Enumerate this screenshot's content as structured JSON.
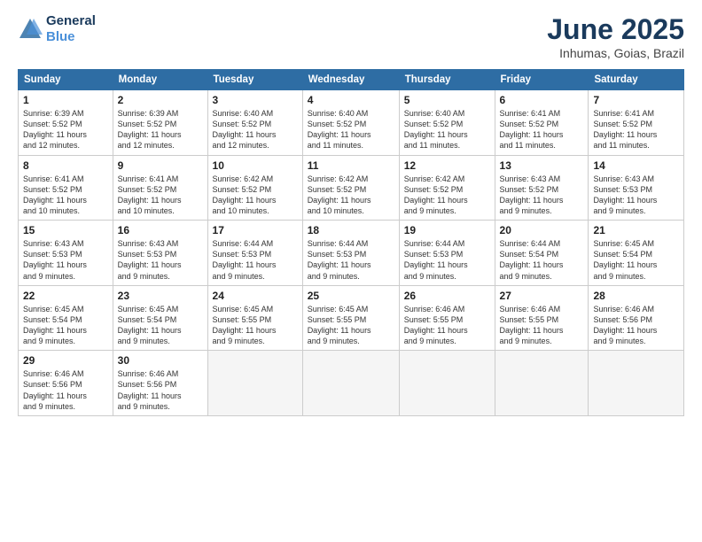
{
  "header": {
    "logo_line1": "General",
    "logo_line2": "Blue",
    "title": "June 2025",
    "subtitle": "Inhumas, Goias, Brazil"
  },
  "weekdays": [
    "Sunday",
    "Monday",
    "Tuesday",
    "Wednesday",
    "Thursday",
    "Friday",
    "Saturday"
  ],
  "weeks": [
    [
      {
        "day": "1",
        "lines": [
          "Sunrise: 6:39 AM",
          "Sunset: 5:52 PM",
          "Daylight: 11 hours",
          "and 12 minutes."
        ]
      },
      {
        "day": "2",
        "lines": [
          "Sunrise: 6:39 AM",
          "Sunset: 5:52 PM",
          "Daylight: 11 hours",
          "and 12 minutes."
        ]
      },
      {
        "day": "3",
        "lines": [
          "Sunrise: 6:40 AM",
          "Sunset: 5:52 PM",
          "Daylight: 11 hours",
          "and 12 minutes."
        ]
      },
      {
        "day": "4",
        "lines": [
          "Sunrise: 6:40 AM",
          "Sunset: 5:52 PM",
          "Daylight: 11 hours",
          "and 11 minutes."
        ]
      },
      {
        "day": "5",
        "lines": [
          "Sunrise: 6:40 AM",
          "Sunset: 5:52 PM",
          "Daylight: 11 hours",
          "and 11 minutes."
        ]
      },
      {
        "day": "6",
        "lines": [
          "Sunrise: 6:41 AM",
          "Sunset: 5:52 PM",
          "Daylight: 11 hours",
          "and 11 minutes."
        ]
      },
      {
        "day": "7",
        "lines": [
          "Sunrise: 6:41 AM",
          "Sunset: 5:52 PM",
          "Daylight: 11 hours",
          "and 11 minutes."
        ]
      }
    ],
    [
      {
        "day": "8",
        "lines": [
          "Sunrise: 6:41 AM",
          "Sunset: 5:52 PM",
          "Daylight: 11 hours",
          "and 10 minutes."
        ]
      },
      {
        "day": "9",
        "lines": [
          "Sunrise: 6:41 AM",
          "Sunset: 5:52 PM",
          "Daylight: 11 hours",
          "and 10 minutes."
        ]
      },
      {
        "day": "10",
        "lines": [
          "Sunrise: 6:42 AM",
          "Sunset: 5:52 PM",
          "Daylight: 11 hours",
          "and 10 minutes."
        ]
      },
      {
        "day": "11",
        "lines": [
          "Sunrise: 6:42 AM",
          "Sunset: 5:52 PM",
          "Daylight: 11 hours",
          "and 10 minutes."
        ]
      },
      {
        "day": "12",
        "lines": [
          "Sunrise: 6:42 AM",
          "Sunset: 5:52 PM",
          "Daylight: 11 hours",
          "and 9 minutes."
        ]
      },
      {
        "day": "13",
        "lines": [
          "Sunrise: 6:43 AM",
          "Sunset: 5:52 PM",
          "Daylight: 11 hours",
          "and 9 minutes."
        ]
      },
      {
        "day": "14",
        "lines": [
          "Sunrise: 6:43 AM",
          "Sunset: 5:53 PM",
          "Daylight: 11 hours",
          "and 9 minutes."
        ]
      }
    ],
    [
      {
        "day": "15",
        "lines": [
          "Sunrise: 6:43 AM",
          "Sunset: 5:53 PM",
          "Daylight: 11 hours",
          "and 9 minutes."
        ]
      },
      {
        "day": "16",
        "lines": [
          "Sunrise: 6:43 AM",
          "Sunset: 5:53 PM",
          "Daylight: 11 hours",
          "and 9 minutes."
        ]
      },
      {
        "day": "17",
        "lines": [
          "Sunrise: 6:44 AM",
          "Sunset: 5:53 PM",
          "Daylight: 11 hours",
          "and 9 minutes."
        ]
      },
      {
        "day": "18",
        "lines": [
          "Sunrise: 6:44 AM",
          "Sunset: 5:53 PM",
          "Daylight: 11 hours",
          "and 9 minutes."
        ]
      },
      {
        "day": "19",
        "lines": [
          "Sunrise: 6:44 AM",
          "Sunset: 5:53 PM",
          "Daylight: 11 hours",
          "and 9 minutes."
        ]
      },
      {
        "day": "20",
        "lines": [
          "Sunrise: 6:44 AM",
          "Sunset: 5:54 PM",
          "Daylight: 11 hours",
          "and 9 minutes."
        ]
      },
      {
        "day": "21",
        "lines": [
          "Sunrise: 6:45 AM",
          "Sunset: 5:54 PM",
          "Daylight: 11 hours",
          "and 9 minutes."
        ]
      }
    ],
    [
      {
        "day": "22",
        "lines": [
          "Sunrise: 6:45 AM",
          "Sunset: 5:54 PM",
          "Daylight: 11 hours",
          "and 9 minutes."
        ]
      },
      {
        "day": "23",
        "lines": [
          "Sunrise: 6:45 AM",
          "Sunset: 5:54 PM",
          "Daylight: 11 hours",
          "and 9 minutes."
        ]
      },
      {
        "day": "24",
        "lines": [
          "Sunrise: 6:45 AM",
          "Sunset: 5:55 PM",
          "Daylight: 11 hours",
          "and 9 minutes."
        ]
      },
      {
        "day": "25",
        "lines": [
          "Sunrise: 6:45 AM",
          "Sunset: 5:55 PM",
          "Daylight: 11 hours",
          "and 9 minutes."
        ]
      },
      {
        "day": "26",
        "lines": [
          "Sunrise: 6:46 AM",
          "Sunset: 5:55 PM",
          "Daylight: 11 hours",
          "and 9 minutes."
        ]
      },
      {
        "day": "27",
        "lines": [
          "Sunrise: 6:46 AM",
          "Sunset: 5:55 PM",
          "Daylight: 11 hours",
          "and 9 minutes."
        ]
      },
      {
        "day": "28",
        "lines": [
          "Sunrise: 6:46 AM",
          "Sunset: 5:56 PM",
          "Daylight: 11 hours",
          "and 9 minutes."
        ]
      }
    ],
    [
      {
        "day": "29",
        "lines": [
          "Sunrise: 6:46 AM",
          "Sunset: 5:56 PM",
          "Daylight: 11 hours",
          "and 9 minutes."
        ]
      },
      {
        "day": "30",
        "lines": [
          "Sunrise: 6:46 AM",
          "Sunset: 5:56 PM",
          "Daylight: 11 hours",
          "and 9 minutes."
        ]
      },
      {
        "day": "",
        "lines": []
      },
      {
        "day": "",
        "lines": []
      },
      {
        "day": "",
        "lines": []
      },
      {
        "day": "",
        "lines": []
      },
      {
        "day": "",
        "lines": []
      }
    ]
  ]
}
